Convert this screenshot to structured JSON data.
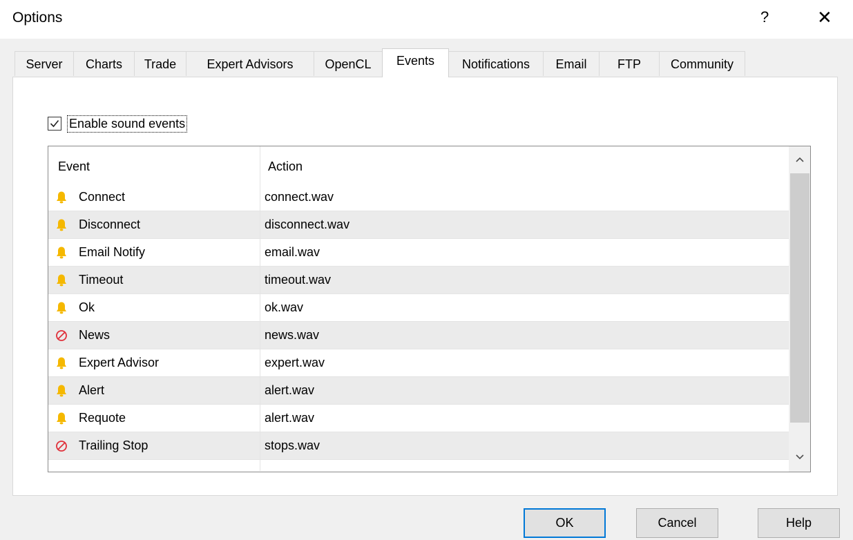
{
  "window": {
    "title": "Options",
    "help_label": "?",
    "close_label": "✕"
  },
  "tabs": [
    {
      "label": "Server"
    },
    {
      "label": "Charts"
    },
    {
      "label": "Trade"
    },
    {
      "label": "Expert Advisors"
    },
    {
      "label": "OpenCL"
    },
    {
      "label": "Events",
      "selected": true
    },
    {
      "label": "Notifications"
    },
    {
      "label": "Email"
    },
    {
      "label": "FTP"
    },
    {
      "label": "Community"
    }
  ],
  "enable_sound": {
    "label": "Enable sound events",
    "checked": true
  },
  "list": {
    "columns": {
      "event": "Event",
      "action": "Action"
    },
    "rows": [
      {
        "icon": "bell-icon",
        "event": "Connect",
        "action": "connect.wav"
      },
      {
        "icon": "bell-icon",
        "event": "Disconnect",
        "action": "disconnect.wav"
      },
      {
        "icon": "bell-icon",
        "event": "Email Notify",
        "action": "email.wav"
      },
      {
        "icon": "bell-icon",
        "event": "Timeout",
        "action": "timeout.wav"
      },
      {
        "icon": "bell-icon",
        "event": "Ok",
        "action": "ok.wav"
      },
      {
        "icon": "disabled-icon",
        "event": "News",
        "action": "news.wav"
      },
      {
        "icon": "bell-icon",
        "event": "Expert Advisor",
        "action": "expert.wav"
      },
      {
        "icon": "bell-icon",
        "event": "Alert",
        "action": "alert.wav"
      },
      {
        "icon": "bell-icon",
        "event": "Requote",
        "action": "alert.wav"
      },
      {
        "icon": "disabled-icon",
        "event": "Trailing Stop",
        "action": "stops.wav"
      }
    ],
    "scroll": {
      "up_icon": "chevron-up-icon",
      "down_icon": "chevron-down-icon"
    }
  },
  "buttons": {
    "ok": "OK",
    "cancel": "Cancel",
    "help": "Help"
  },
  "colors": {
    "accent": "#0078d7",
    "bell": "#f5b800",
    "disabled": "#e0303a"
  }
}
